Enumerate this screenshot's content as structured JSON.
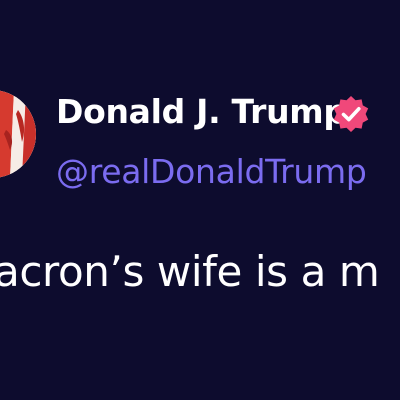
{
  "tweet": {
    "author": {
      "display_name": "Donald J. Trump",
      "handle": "@realDonaldTrump",
      "verified_badge_color": "#f0487a",
      "avatar_icon": "profile-photo"
    },
    "text_visible": "acron’s wife is a m"
  },
  "colors": {
    "background": "#0d0c2e",
    "name_text": "#ffffff",
    "handle_text": "#7b6cf0",
    "body_text": "#ffffff"
  }
}
